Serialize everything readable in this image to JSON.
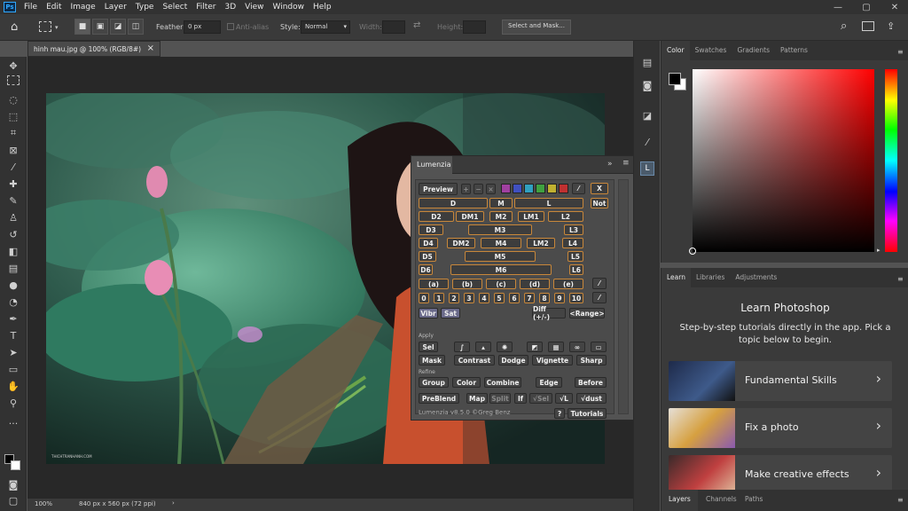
{
  "menubar": {
    "logo": "Ps",
    "items": [
      "File",
      "Edit",
      "Image",
      "Layer",
      "Type",
      "Select",
      "Filter",
      "3D",
      "View",
      "Window",
      "Help"
    ],
    "minimize": "—",
    "maximize": "▢",
    "close": "✕"
  },
  "options": {
    "feather_label": "Feather:",
    "feather_value": "0 px",
    "antialias_label": "Anti-alias",
    "style_label": "Style:",
    "style_value": "Normal",
    "width_label": "Width:",
    "height_label": "Height:",
    "select_mask": "Select and Mask..."
  },
  "document": {
    "tab_title": "hinh mau.jpg @ 100% (RGB/8#)",
    "close": "×",
    "zoom": "100%",
    "size_info": "840 px x 560 px (72 ppi)",
    "watermark": "THICHTRANHANH.COM"
  },
  "lumenzia": {
    "title": "Lumenzia",
    "collapse": "»",
    "preview": "Preview",
    "plus": "+",
    "minus": "−",
    "x_btn": "X",
    "not_btn": "Not",
    "zones": [
      "D",
      "M",
      "L",
      "D2",
      "DM1",
      "M2",
      "LM1",
      "L2",
      "D3",
      "M3",
      "L3",
      "D4",
      "DM2",
      "M4",
      "LM2",
      "L4",
      "D5",
      "M5",
      "L5",
      "D6",
      "M6",
      "L6"
    ],
    "letters": [
      "(a)",
      "(b)",
      "(c)",
      "(d)",
      "(e)"
    ],
    "numbers": [
      "0",
      "1",
      "2",
      "3",
      "4",
      "5",
      "6",
      "7",
      "8",
      "9",
      "10"
    ],
    "vibr": "Vibr",
    "sat": "Sat",
    "diff": "Diff (+/-)",
    "range": "<Range>",
    "apply_label": "Apply",
    "sel": "Sel",
    "mask": "Mask",
    "contrast": "Contrast",
    "dodge": "Dodge",
    "vignette": "Vignette",
    "sharp": "Sharp",
    "refine_label": "Refine",
    "group": "Group",
    "color": "Color",
    "combine": "Combine",
    "edge": "Edge",
    "before": "Before",
    "preblend": "PreBlend",
    "map": "Map",
    "split": "Split",
    "if": "If",
    "vsel": "√Sel",
    "vl": "√L",
    "vdust": "√dust",
    "version": "Lumenzia v8.5.0 ©Greg Benz",
    "help": "?",
    "tutorials": "Tutorials",
    "swatch_colors": [
      "#a040a0",
      "#4050c0",
      "#30a0c0",
      "#40a040",
      "#c0b030",
      "#c03030"
    ]
  },
  "color_panel": {
    "tabs": [
      "Color",
      "Swatches",
      "Gradients",
      "Patterns"
    ],
    "active": "Color",
    "fg": "#000000",
    "bg": "#ffffff",
    "hue": "#ff0000"
  },
  "learn_panel": {
    "tabs": [
      "Learn",
      "Libraries",
      "Adjustments"
    ],
    "active": "Learn",
    "title": "Learn Photoshop",
    "description": "Step-by-step tutorials directly in the app. Pick a topic below to begin.",
    "cards": [
      {
        "label": "Fundamental Skills"
      },
      {
        "label": "Fix a photo"
      },
      {
        "label": "Make creative effects"
      }
    ]
  },
  "bottom_tabs": [
    "Layers",
    "Channels",
    "Paths"
  ]
}
